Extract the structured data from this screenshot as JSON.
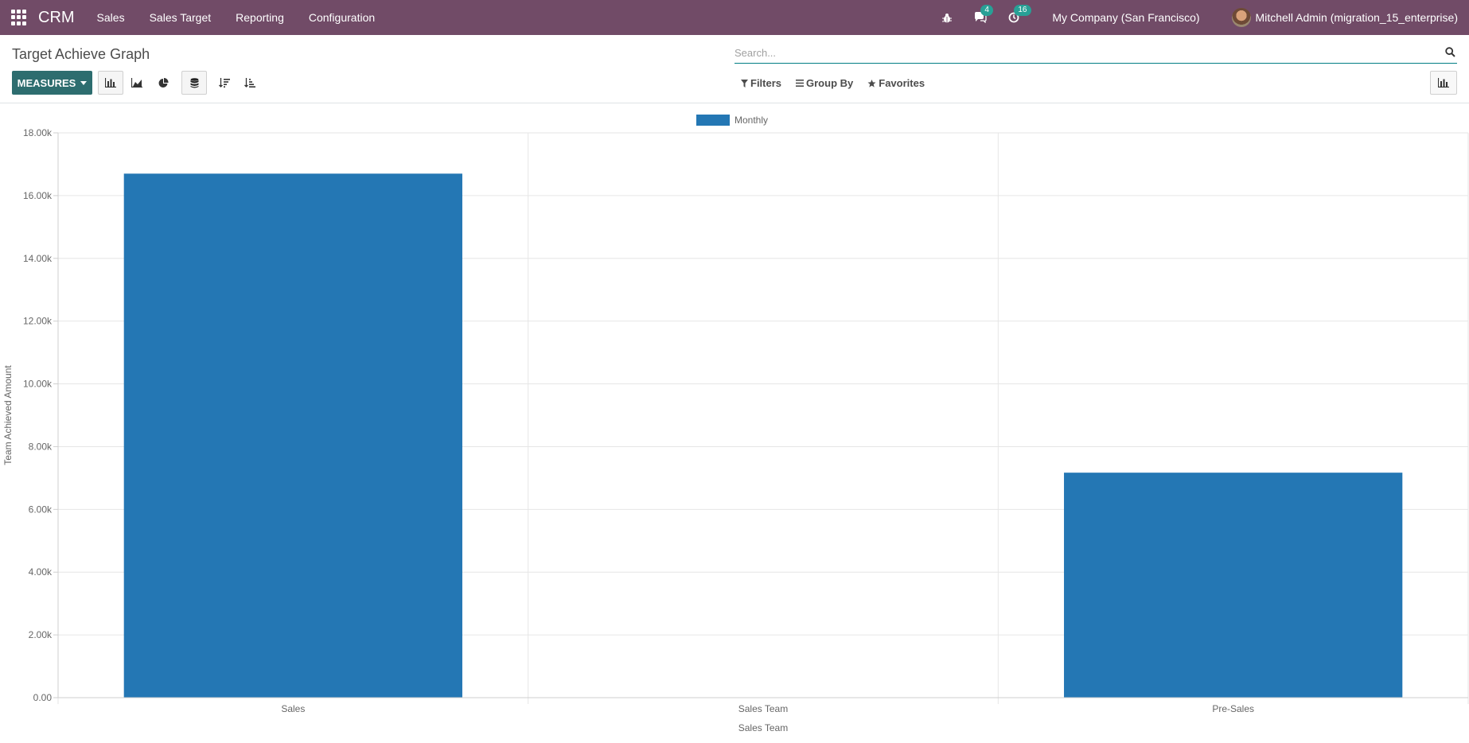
{
  "navbar": {
    "brand": "CRM",
    "menu": [
      "Sales",
      "Sales Target",
      "Reporting",
      "Configuration"
    ],
    "messages_count": "4",
    "activities_count": "16",
    "company": "My Company (San Francisco)",
    "user": "Mitchell Admin (migration_15_enterprise)"
  },
  "control_panel": {
    "title": "Target Achieve Graph",
    "search_placeholder": "Search...",
    "measures_label": "MEASURES",
    "filters_label": "Filters",
    "group_by_label": "Group By",
    "favorites_label": "Favorites"
  },
  "colors": {
    "navbar": "#714b67",
    "primary_button": "#2d6d6f",
    "bar": "#2477b4"
  },
  "chart_data": {
    "type": "bar",
    "legend": "Monthly",
    "categories": [
      "Sales",
      "Sales Team",
      "Pre-Sales"
    ],
    "series": [
      {
        "name": "Monthly",
        "values": [
          16700,
          0,
          7170
        ]
      }
    ],
    "xlabel": "Sales Team",
    "ylabel": "Team Achieved Amount",
    "ylim": [
      0,
      18000
    ],
    "yticks": [
      "0.00",
      "2.00k",
      "4.00k",
      "6.00k",
      "8.00k",
      "10.00k",
      "12.00k",
      "14.00k",
      "16.00k",
      "18.00k"
    ],
    "grid": true,
    "legend_position": "top-center"
  }
}
